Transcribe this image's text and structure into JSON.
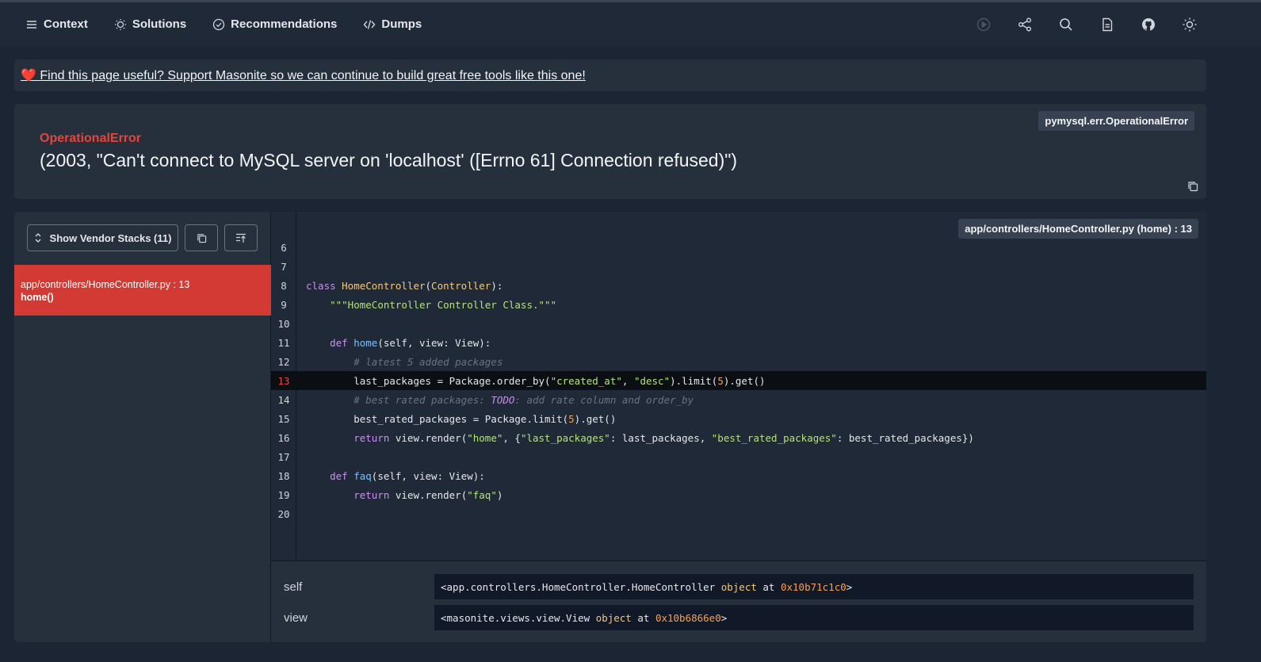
{
  "nav": {
    "tabs": [
      {
        "label": "Context",
        "icon": "list-icon"
      },
      {
        "label": "Solutions",
        "icon": "lightbulb-icon"
      },
      {
        "label": "Recommendations",
        "icon": "check-circle-icon"
      },
      {
        "label": "Dumps",
        "icon": "code-icon"
      }
    ],
    "right_icons": [
      "play-circle-icon",
      "share-icon",
      "search-icon",
      "document-icon",
      "github-icon",
      "sun-icon"
    ]
  },
  "support": {
    "heart": "❤️",
    "text": "Find this page useful? Support Masonite so we can continue to build great free tools like this one!"
  },
  "error": {
    "class_badge": "pymysql.err.OperationalError",
    "type": "OperationalError",
    "message": "(2003, \"Can't connect to MySQL server on 'localhost' ([Errno 61] Connection refused)\")"
  },
  "stack": {
    "vendor_button": "Show Vendor Stacks (11)",
    "frame": {
      "file": "app/controllers/HomeController.py : 13",
      "method": "home()"
    },
    "file_badge": "app/controllers/HomeController.py (home) : 13",
    "active_line": 13,
    "code": [
      {
        "n": "6",
        "parts": []
      },
      {
        "n": "7",
        "parts": []
      },
      {
        "n": "8",
        "parts": [
          [
            "kw",
            "class "
          ],
          [
            "cls",
            "HomeController"
          ],
          [
            "",
            "("
          ],
          [
            "cls",
            "Controller"
          ],
          [
            "",
            "):"
          ]
        ]
      },
      {
        "n": "9",
        "parts": [
          [
            "",
            "    "
          ],
          [
            "str",
            "\"\"\"HomeController Controller Class.\"\"\""
          ]
        ]
      },
      {
        "n": "10",
        "parts": []
      },
      {
        "n": "11",
        "parts": [
          [
            "",
            "    "
          ],
          [
            "kw",
            "def "
          ],
          [
            "fn",
            "home"
          ],
          [
            "",
            "(self, view: View):"
          ]
        ]
      },
      {
        "n": "12",
        "parts": [
          [
            "",
            "        "
          ],
          [
            "cm",
            "# latest 5 added packages"
          ]
        ]
      },
      {
        "n": "13",
        "parts": [
          [
            "",
            "        last_packages = Package.order_by("
          ],
          [
            "str",
            "\"created_at\""
          ],
          [
            "",
            ", "
          ],
          [
            "str",
            "\"desc\""
          ],
          [
            "",
            ").limit("
          ],
          [
            "num",
            "5"
          ],
          [
            "",
            ").get()"
          ]
        ]
      },
      {
        "n": "14",
        "parts": [
          [
            "",
            "        "
          ],
          [
            "cm",
            "# best rated packages: "
          ],
          [
            "todo",
            "TODO"
          ],
          [
            "cm",
            ": add rate column and order_by"
          ]
        ]
      },
      {
        "n": "15",
        "parts": [
          [
            "",
            "        best_rated_packages = Package.limit("
          ],
          [
            "num",
            "5"
          ],
          [
            "",
            ").get()"
          ]
        ]
      },
      {
        "n": "16",
        "parts": [
          [
            "",
            "        "
          ],
          [
            "kw",
            "return "
          ],
          [
            "",
            "view.render("
          ],
          [
            "str",
            "\"home\""
          ],
          [
            "",
            ", {"
          ],
          [
            "str",
            "\"last_packages\""
          ],
          [
            "",
            ": last_packages, "
          ],
          [
            "str",
            "\"best_rated_packages\""
          ],
          [
            "",
            ": best_rated_packages})"
          ]
        ]
      },
      {
        "n": "17",
        "parts": []
      },
      {
        "n": "18",
        "parts": [
          [
            "",
            "    "
          ],
          [
            "kw",
            "def "
          ],
          [
            "fn",
            "faq"
          ],
          [
            "",
            "(self, view: View):"
          ]
        ]
      },
      {
        "n": "19",
        "parts": [
          [
            "",
            "        "
          ],
          [
            "kw",
            "return "
          ],
          [
            "",
            "view.render("
          ],
          [
            "str",
            "\"faq\""
          ],
          [
            "",
            ")"
          ]
        ]
      },
      {
        "n": "20",
        "parts": []
      }
    ],
    "variables": [
      {
        "name": "self",
        "prefix": "<app.controllers.HomeController.HomeController ",
        "obj": "object",
        "mid": " at ",
        "addr": "0x10b71c1c0",
        "suffix": ">"
      },
      {
        "name": "view",
        "prefix": "<masonite.views.view.View ",
        "obj": "object",
        "mid": " at ",
        "addr": "0x10b6866e0",
        "suffix": ">"
      }
    ]
  }
}
